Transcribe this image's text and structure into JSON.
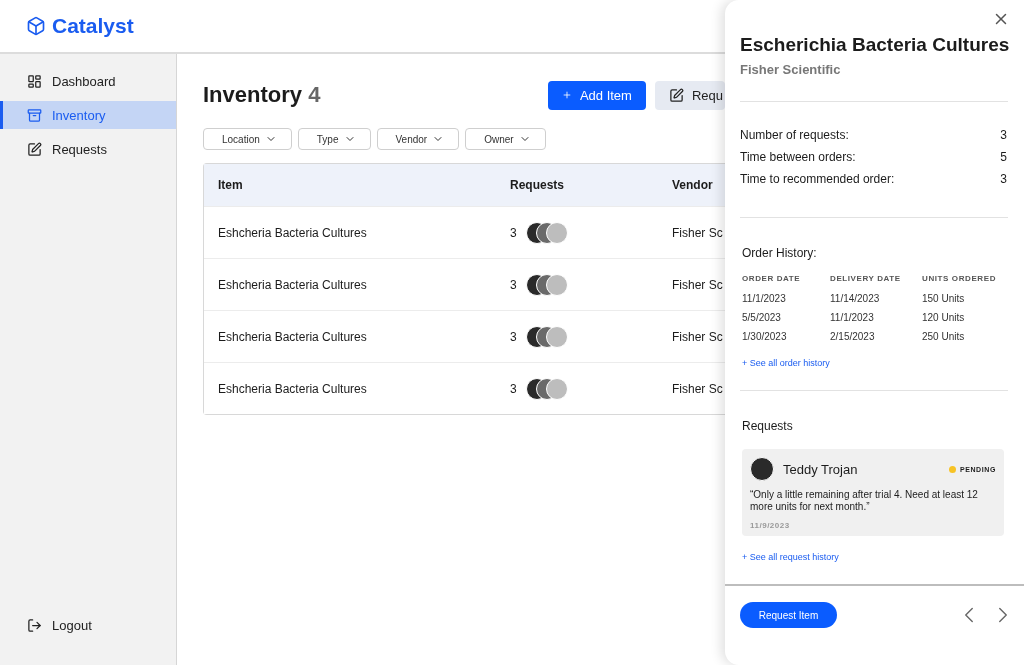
{
  "brand": {
    "name": "Catalyst"
  },
  "sidebar": {
    "items": [
      {
        "label": "Dashboard",
        "kind": "dashboard",
        "selected": false
      },
      {
        "label": "Inventory",
        "kind": "inventory",
        "selected": true
      },
      {
        "label": "Requests",
        "kind": "requests",
        "selected": false
      }
    ],
    "logout": "Logout"
  },
  "page": {
    "title": "Inventory",
    "count": "4",
    "buttons": [
      {
        "label": "Add Item",
        "kind": "primary"
      },
      {
        "label": "Requ",
        "kind": "secondary"
      }
    ],
    "filters": [
      "Location",
      "Type",
      "Vendor",
      "Owner"
    ]
  },
  "table": {
    "columns": [
      "Item",
      "Requests",
      "Vendor"
    ],
    "rows": [
      {
        "item": "Eshcheria Bacteria Cultures",
        "requests": "3",
        "vendor": "Fisher Sc"
      },
      {
        "item": "Eshcheria Bacteria Cultures",
        "requests": "3",
        "vendor": "Fisher Sc"
      },
      {
        "item": "Eshcheria Bacteria Cultures",
        "requests": "3",
        "vendor": "Fisher Sc"
      },
      {
        "item": "Eshcheria Bacteria Cultures",
        "requests": "3",
        "vendor": "Fisher Sc"
      }
    ]
  },
  "drawer": {
    "title": "Escherichia Bacteria Cultures",
    "subtitle": "Fisher Scientific",
    "stats": [
      {
        "label": "Number of requests:",
        "value": "3"
      },
      {
        "label": "Time between orders:",
        "value": "5"
      },
      {
        "label": "Time to recommended order:",
        "value": "3"
      }
    ],
    "order_history": {
      "title": "Order History:",
      "columns": [
        "ORDER DATE",
        "DELIVERY DATE",
        "UNITS ORDERED"
      ],
      "rows": [
        [
          "11/1/2023",
          "11/14/2023",
          "150 Units"
        ],
        [
          "5/5/2023",
          "11/1/2023",
          "120 Units"
        ],
        [
          "1/30/2023",
          "2/15/2023",
          "250 Units"
        ]
      ],
      "link": "+ See all order history"
    },
    "requests": {
      "title": "Requests",
      "items": [
        {
          "name": "Teddy Trojan",
          "status": "PENDING",
          "color": "#f7c325",
          "quote": "“Only a little remaining after trial 4. Need at least 12 more units for next month.”",
          "date": "11/9/2023"
        }
      ],
      "link": "+ See all request history"
    },
    "button": "Request Item"
  }
}
